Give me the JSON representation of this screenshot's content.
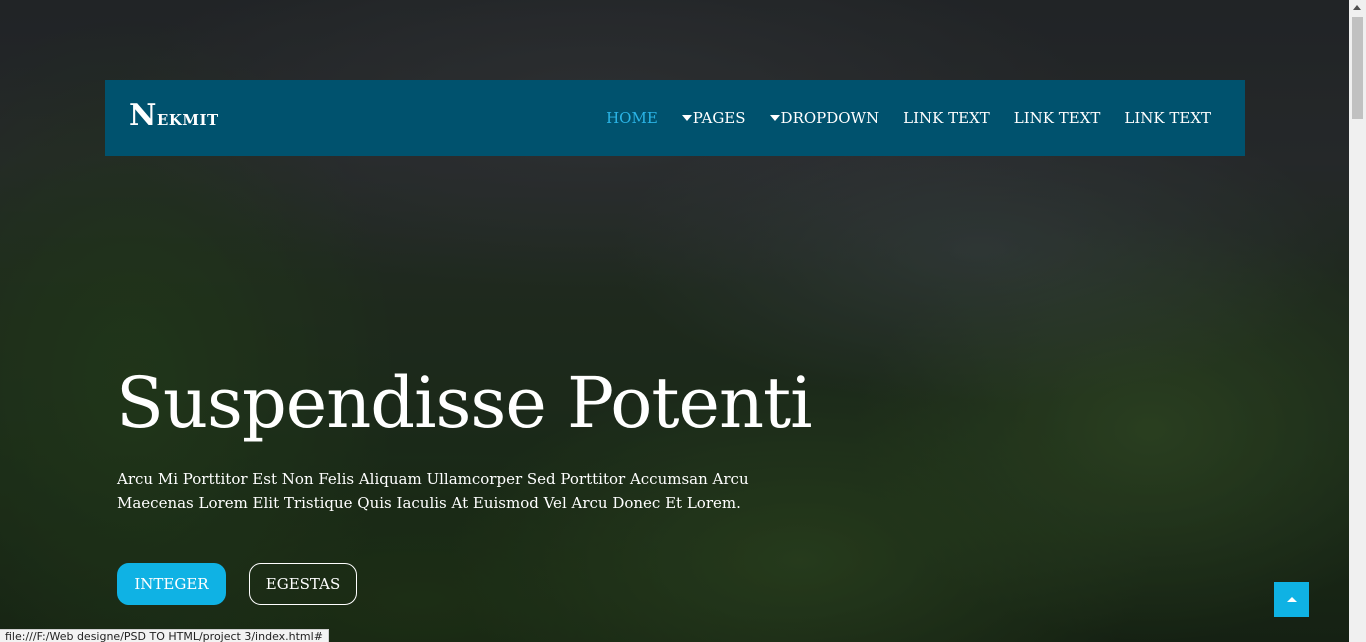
{
  "brand": {
    "first_letter": "N",
    "rest": "ekmit"
  },
  "nav": {
    "items": [
      {
        "label": "HOME",
        "active": true,
        "has_caret": false
      },
      {
        "label": "PAGES",
        "active": false,
        "has_caret": true
      },
      {
        "label": "DROPDOWN",
        "active": false,
        "has_caret": true
      },
      {
        "label": "LINK TEXT",
        "active": false,
        "has_caret": false
      },
      {
        "label": "LINK TEXT",
        "active": false,
        "has_caret": false
      },
      {
        "label": "LINK TEXT",
        "active": false,
        "has_caret": false
      }
    ]
  },
  "hero": {
    "title": "Suspendisse Potenti",
    "text": "Arcu Mi Porttitor Est Non Felis Aliquam Ullamcorper Sed Porttitor Accumsan Arcu Maecenas Lorem Elit Tristique Quis Iaculis At Euismod Vel Arcu Donec Et Lorem.",
    "primary_button": "INTEGER",
    "secondary_button": "EGESTAS"
  },
  "status_bar": {
    "url": "file:///F:/Web designe/PSD TO HTML/project 3/index.html#"
  },
  "colors": {
    "navbar": "#00526e",
    "accent": "#0fb2e4",
    "active_link": "#2ab4e6"
  },
  "icons": {
    "back_to_top": "caret-up-icon",
    "dropdown": "caret-down-icon"
  }
}
